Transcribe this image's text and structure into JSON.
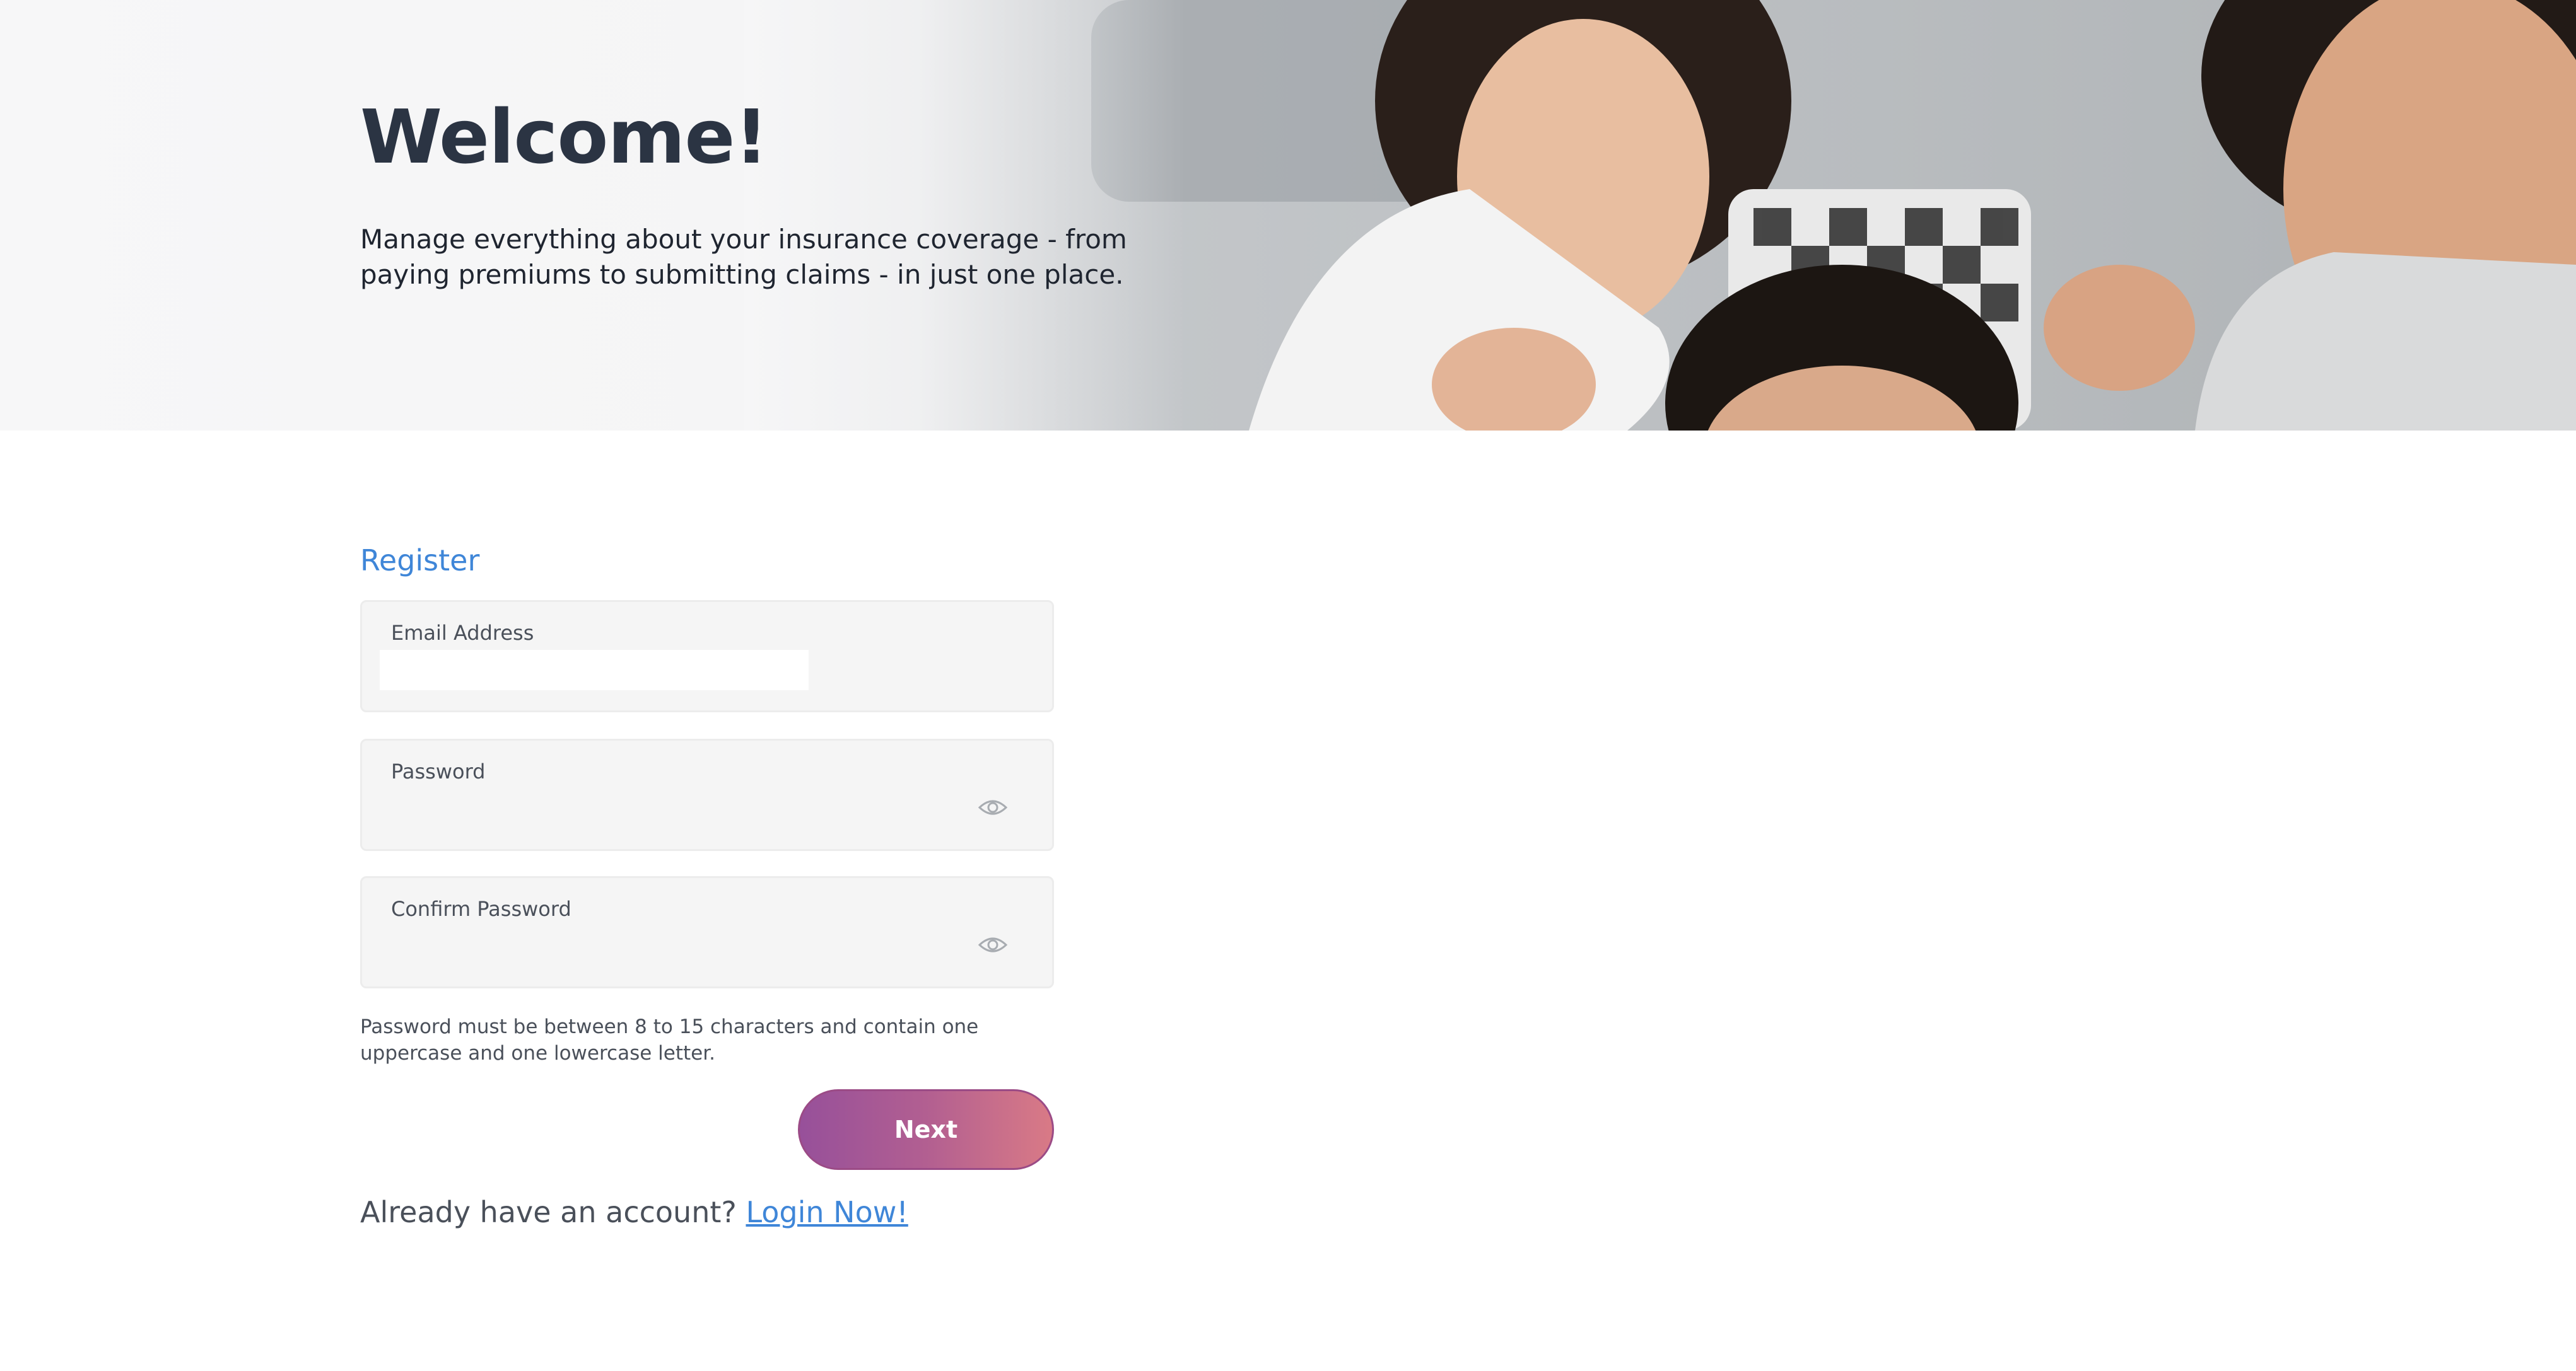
{
  "hero": {
    "title": "Welcome!",
    "subtitle": "Manage everything about your insurance coverage - from paying premiums to submitting claims - in just one place.",
    "image_icon": "family-photo"
  },
  "form": {
    "tab_label": "Register",
    "email": {
      "label": "Email Address",
      "value": "",
      "placeholder": ""
    },
    "password": {
      "label": "Password",
      "value": "",
      "placeholder": "",
      "toggle_icon": "eye-icon"
    },
    "confirm_password": {
      "label": "Confirm Password",
      "value": "",
      "placeholder": "",
      "toggle_icon": "eye-icon"
    },
    "hint": "Password must be between 8 to 15 characters and contain one uppercase and one lowercase letter.",
    "next_label": "Next",
    "login_prompt": "Already have an account?",
    "login_link": "Login Now!"
  },
  "colors": {
    "accent_link": "#3f86d8",
    "button_gradient_start": "#97509a",
    "button_gradient_end": "#d97a86",
    "heading": "#2b3443"
  }
}
